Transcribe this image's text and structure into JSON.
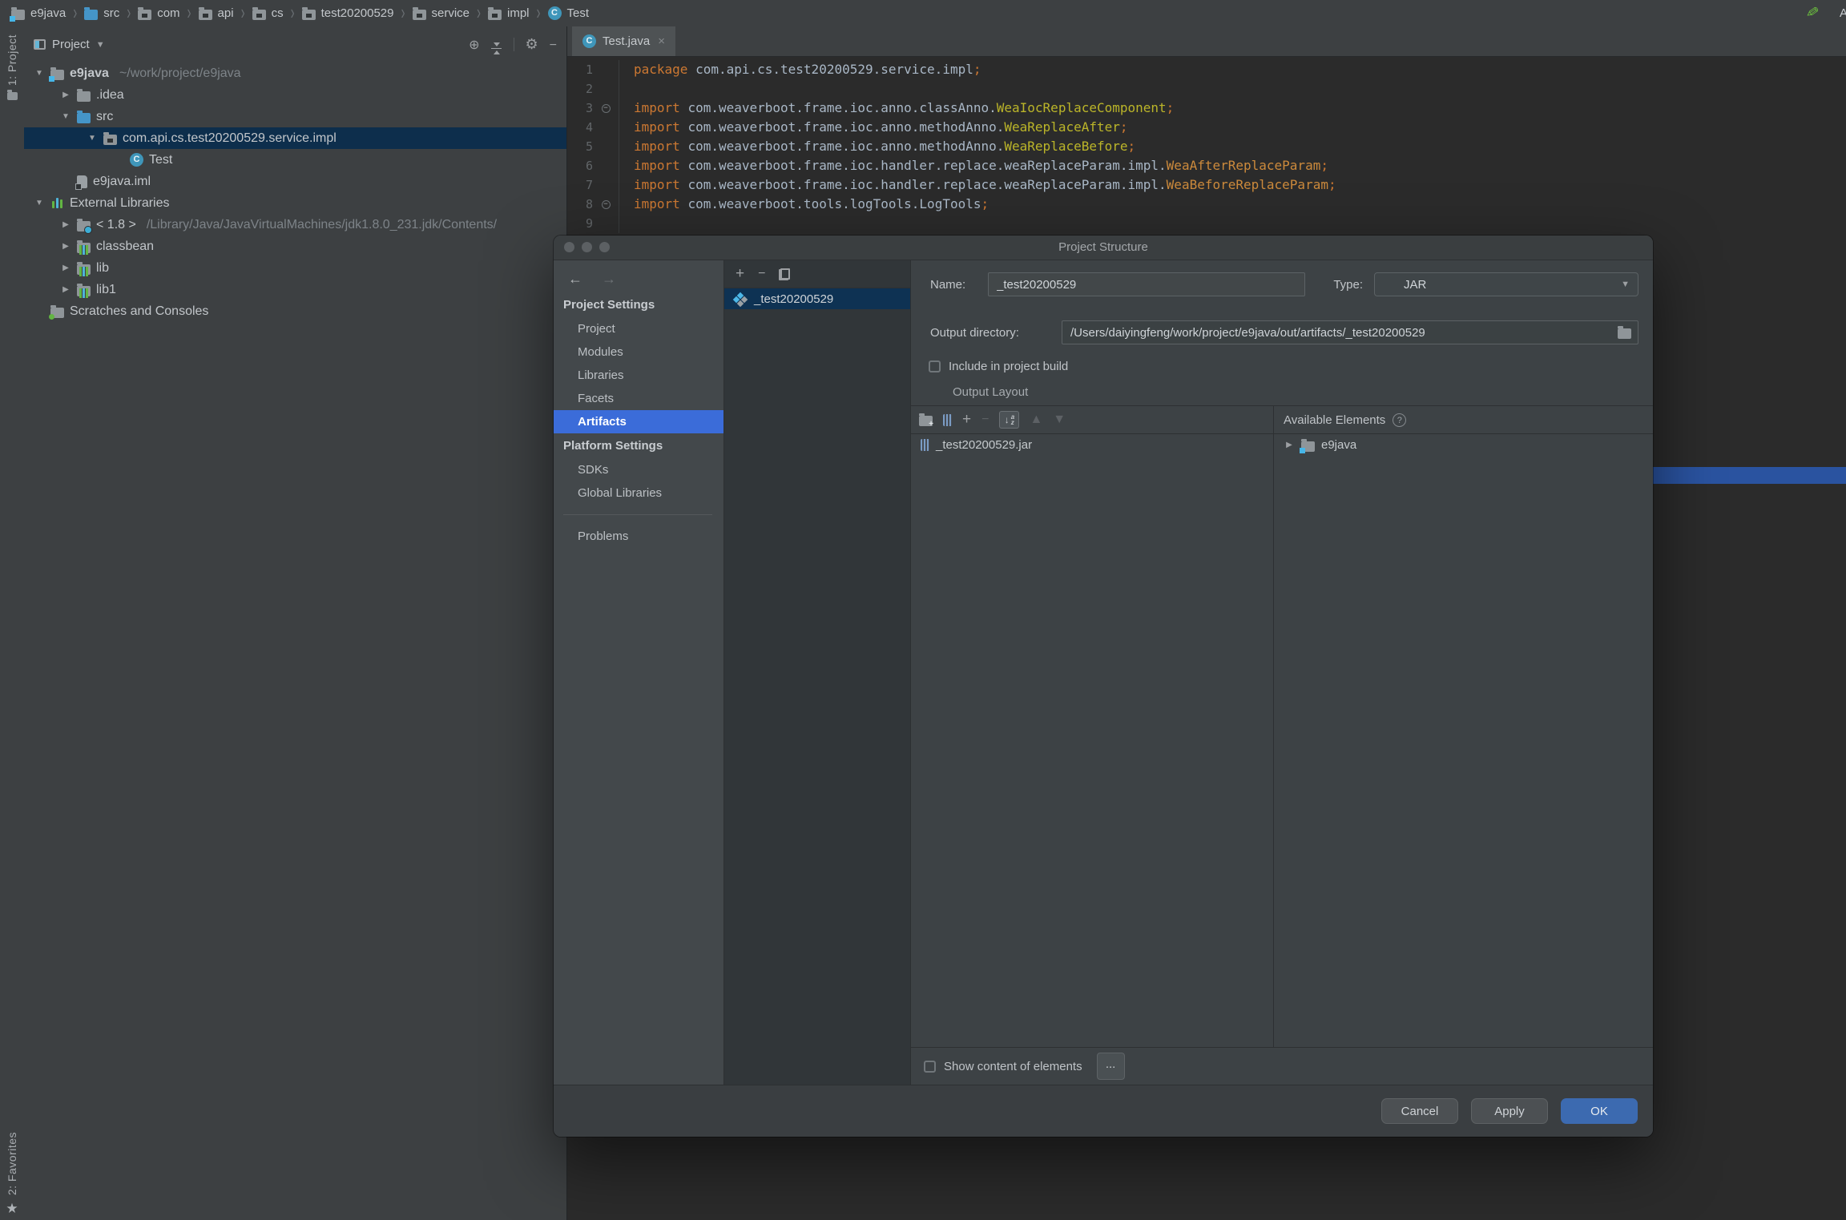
{
  "breadcrumb": {
    "items": [
      {
        "label": "e9java",
        "icon": "folder-project"
      },
      {
        "label": "src",
        "icon": "folder-src"
      },
      {
        "label": "com",
        "icon": "folder-pkg"
      },
      {
        "label": "api",
        "icon": "folder-pkg"
      },
      {
        "label": "cs",
        "icon": "folder-pkg"
      },
      {
        "label": "test20200529",
        "icon": "folder-pkg"
      },
      {
        "label": "service",
        "icon": "folder-pkg"
      },
      {
        "label": "impl",
        "icon": "folder-pkg"
      },
      {
        "label": "Test",
        "icon": "class"
      }
    ],
    "partial_right_label": "A"
  },
  "stripes": {
    "top": "1: Project",
    "bottom": "2: Favorites"
  },
  "project_panel": {
    "title": "Project",
    "header_icons": [
      "locate",
      "collapse-all",
      "gear",
      "hide"
    ],
    "tree": [
      {
        "depth": 0,
        "arrow": "down",
        "icon": "folder-project",
        "label": "e9java",
        "dim": "~/work/project/e9java",
        "bold": true
      },
      {
        "depth": 1,
        "arrow": "right",
        "icon": "folder",
        "label": ".idea"
      },
      {
        "depth": 1,
        "arrow": "down",
        "icon": "folder-src",
        "label": "src"
      },
      {
        "depth": 2,
        "arrow": "down",
        "icon": "folder-pkg",
        "label": "com.api.cs.test20200529.service.impl",
        "selected": true
      },
      {
        "depth": 3,
        "arrow": "none",
        "icon": "class",
        "label": "Test"
      },
      {
        "depth": 1,
        "arrow": "none",
        "icon": "iml",
        "label": "e9java.iml"
      },
      {
        "depth": 0,
        "arrow": "down",
        "icon": "libstack",
        "label": "External Libraries"
      },
      {
        "depth": 1,
        "arrow": "right",
        "icon": "jdk",
        "label": "< 1.8 >",
        "dim": "/Library/Java/JavaVirtualMachines/jdk1.8.0_231.jdk/Contents/"
      },
      {
        "depth": 1,
        "arrow": "right",
        "icon": "lib",
        "label": "classbean"
      },
      {
        "depth": 1,
        "arrow": "right",
        "icon": "lib",
        "label": "lib"
      },
      {
        "depth": 1,
        "arrow": "right",
        "icon": "lib",
        "label": "lib1"
      },
      {
        "depth": 0,
        "arrow": "none",
        "icon": "scratches",
        "label": "Scratches and Consoles"
      }
    ]
  },
  "editor": {
    "tab": {
      "title": "Test.java",
      "close": "×"
    },
    "code": [
      {
        "n": "1",
        "fold": false,
        "segs": [
          [
            "kw",
            "package "
          ],
          [
            "pl",
            "com.api.cs.test20200529.service.impl"
          ],
          [
            "kw",
            ";"
          ]
        ]
      },
      {
        "n": "2",
        "fold": false,
        "segs": []
      },
      {
        "n": "3",
        "fold": true,
        "segs": [
          [
            "kw",
            "import "
          ],
          [
            "pl",
            "com.weaverboot.frame.ioc.anno.classAnno."
          ],
          [
            "ann",
            "WeaIocReplaceComponent"
          ],
          [
            "kw",
            ";"
          ]
        ]
      },
      {
        "n": "4",
        "fold": false,
        "segs": [
          [
            "kw",
            "import "
          ],
          [
            "pl",
            "com.weaverboot.frame.ioc.anno.methodAnno."
          ],
          [
            "ann",
            "WeaReplaceAfter"
          ],
          [
            "kw",
            ";"
          ]
        ]
      },
      {
        "n": "5",
        "fold": false,
        "segs": [
          [
            "kw",
            "import "
          ],
          [
            "pl",
            "com.weaverboot.frame.ioc.anno.methodAnno."
          ],
          [
            "ann",
            "WeaReplaceBefore"
          ],
          [
            "kw",
            ";"
          ]
        ]
      },
      {
        "n": "6",
        "fold": false,
        "segs": [
          [
            "kw",
            "import "
          ],
          [
            "pl",
            "com.weaverboot.frame.ioc.handler.replace.weaReplaceParam.impl."
          ],
          [
            "cls",
            "WeaAfterReplaceParam"
          ],
          [
            "kw",
            ";"
          ]
        ]
      },
      {
        "n": "7",
        "fold": false,
        "segs": [
          [
            "kw",
            "import "
          ],
          [
            "pl",
            "com.weaverboot.frame.ioc.handler.replace.weaReplaceParam.impl."
          ],
          [
            "cls",
            "WeaBeforeReplaceParam"
          ],
          [
            "kw",
            ";"
          ]
        ]
      },
      {
        "n": "8",
        "fold": true,
        "segs": [
          [
            "kw",
            "import "
          ],
          [
            "pl",
            "com.weaverboot.tools.logTools.LogTools"
          ],
          [
            "kw",
            ";"
          ]
        ]
      },
      {
        "n": "9",
        "fold": false,
        "segs": []
      }
    ]
  },
  "dialog": {
    "title": "Project Structure",
    "nav": {
      "back": "←",
      "forward": "→"
    },
    "sidebar": [
      {
        "header": "Project Settings",
        "items": [
          {
            "label": "Project"
          },
          {
            "label": "Modules"
          },
          {
            "label": "Libraries"
          },
          {
            "label": "Facets"
          },
          {
            "label": "Artifacts",
            "selected": true
          }
        ]
      },
      {
        "header": "Platform Settings",
        "items": [
          {
            "label": "SDKs"
          },
          {
            "label": "Global Libraries"
          }
        ]
      },
      {
        "header": null,
        "separator": true,
        "items": [
          {
            "label": "Problems"
          }
        ]
      }
    ],
    "artifact_list": {
      "toolbar": [
        "add",
        "remove",
        "copy"
      ],
      "items": [
        {
          "icon": "artifact",
          "label": "_test20200529",
          "selected": true
        }
      ]
    },
    "form": {
      "name_label": "Name:",
      "name_value": "_test20200529",
      "type_label": "Type:",
      "type_value": "JAR",
      "output_dir_label": "Output directory:",
      "output_dir_value": "/Users/daiyingfeng/work/project/e9java/out/artifacts/_test20200529",
      "include_checkbox_label": "Include in project build",
      "output_layout_label": "Output Layout",
      "layout_toolbar": [
        "folder-add",
        "jar",
        "add",
        "remove-dis",
        "sort",
        "move-up",
        "move-down"
      ],
      "available_header": "Available Elements",
      "output_tree": [
        {
          "icon": "jar",
          "label": "_test20200529.jar"
        }
      ],
      "available_tree": [
        {
          "icon": "folder-project",
          "label": "e9java",
          "arrow": "right"
        }
      ],
      "show_content_checkbox_label": "Show content of elements",
      "browse_button_label": "..."
    },
    "footer": {
      "cancel": "Cancel",
      "apply": "Apply",
      "ok": "OK"
    }
  },
  "colors": {
    "accent_selection": "#3b6cd9",
    "unfocused_selection": "#0e3253",
    "tree_selection": "#0d2e4c",
    "ok_button": "#3c6ab0",
    "keyword": "#cc7832",
    "annotation": "#bbb529",
    "editor_stripe": "#2a53a0"
  }
}
